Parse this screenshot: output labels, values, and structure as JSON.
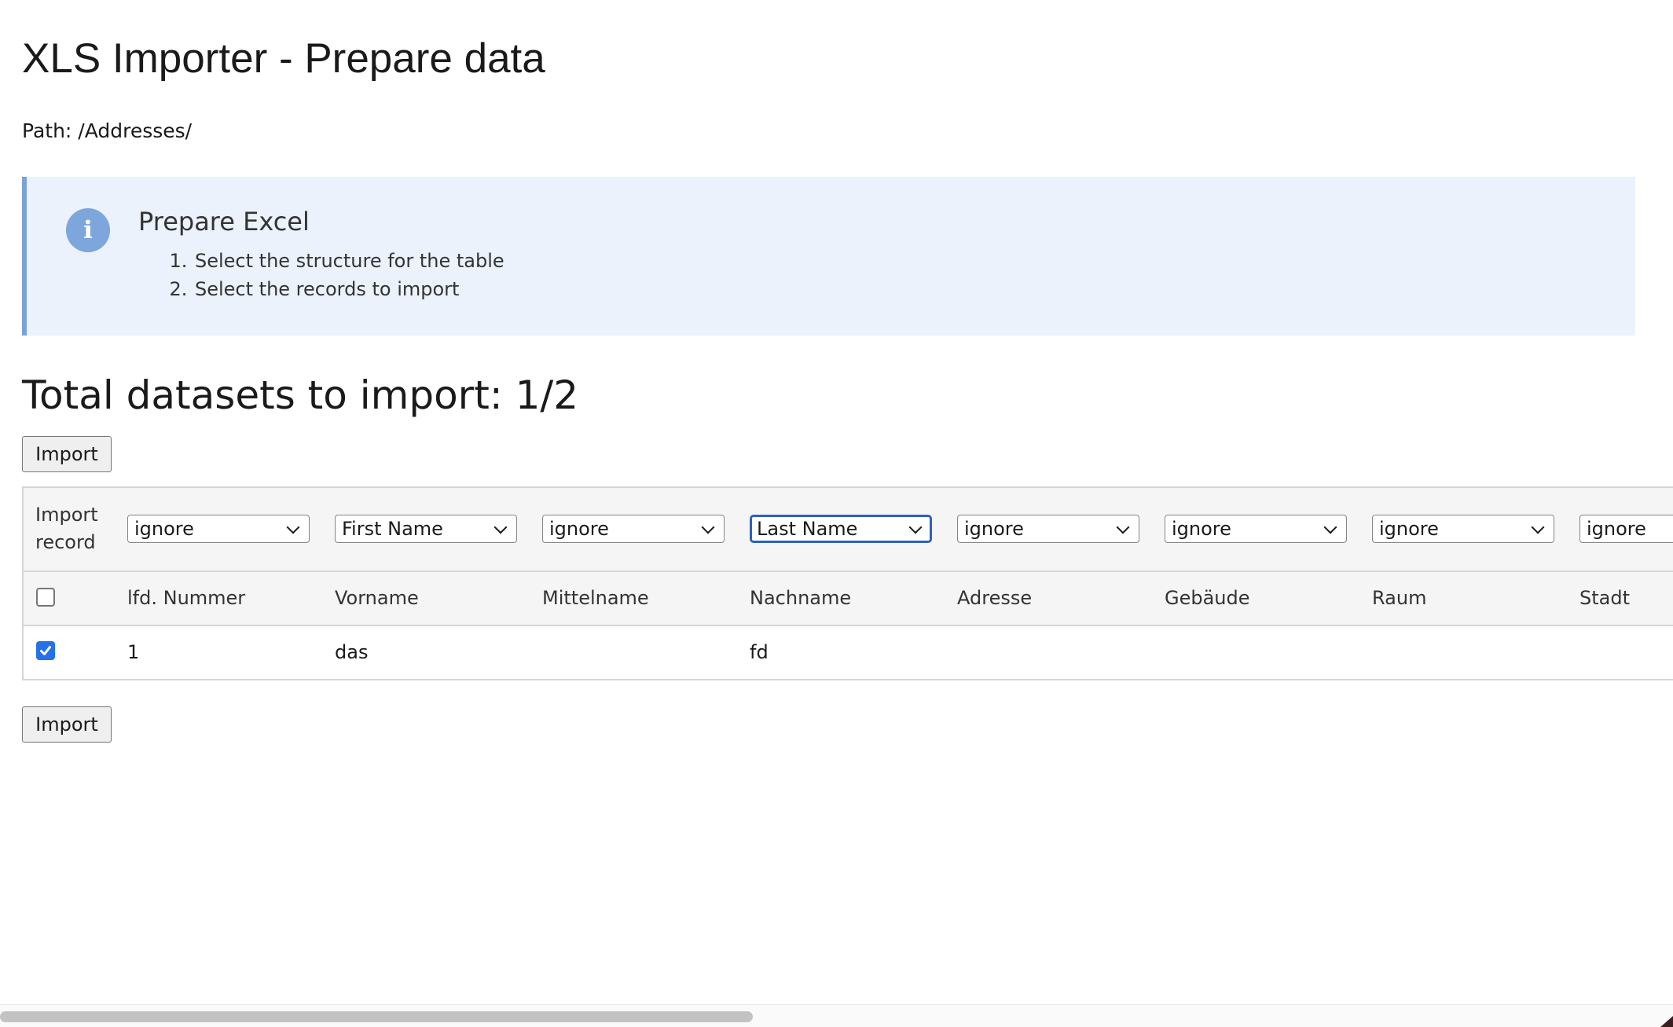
{
  "page": {
    "title": "XLS Importer - Prepare data",
    "path_label": "Path:",
    "path_value": "/Addresses/"
  },
  "info": {
    "icon": "info-icon",
    "icon_glyph": "i",
    "title": "Prepare Excel",
    "steps": [
      "Select the structure for the table",
      "Select the records to import"
    ],
    "accent_color": "#7aa3d6",
    "background_color": "#ebf2fb"
  },
  "summary": {
    "label": "Total datasets to import: 1/2"
  },
  "buttons": {
    "import_top": "Import",
    "import_bottom": "Import"
  },
  "table": {
    "import_record_label_line1": "Import",
    "import_record_label_line2": "record",
    "column_mappings": [
      {
        "selected": "ignore",
        "focused": false
      },
      {
        "selected": "First Name",
        "focused": false
      },
      {
        "selected": "ignore",
        "focused": false
      },
      {
        "selected": "Last Name",
        "focused": true
      },
      {
        "selected": "ignore",
        "focused": false
      },
      {
        "selected": "ignore",
        "focused": false
      },
      {
        "selected": "ignore",
        "focused": false
      },
      {
        "selected": "ignore",
        "focused": false
      }
    ],
    "headers": [
      "lfd. Nummer",
      "Vorname",
      "Mittelname",
      "Nachname",
      "Adresse",
      "Gebäude",
      "Raum",
      "Stadt"
    ],
    "select_all_checked": false,
    "rows": [
      {
        "checked": true,
        "cells": [
          "1",
          "das",
          "",
          "fd",
          "",
          "",
          "",
          ""
        ]
      }
    ]
  },
  "scrollbar": {
    "horizontal_visible_fraction": 0.45
  }
}
